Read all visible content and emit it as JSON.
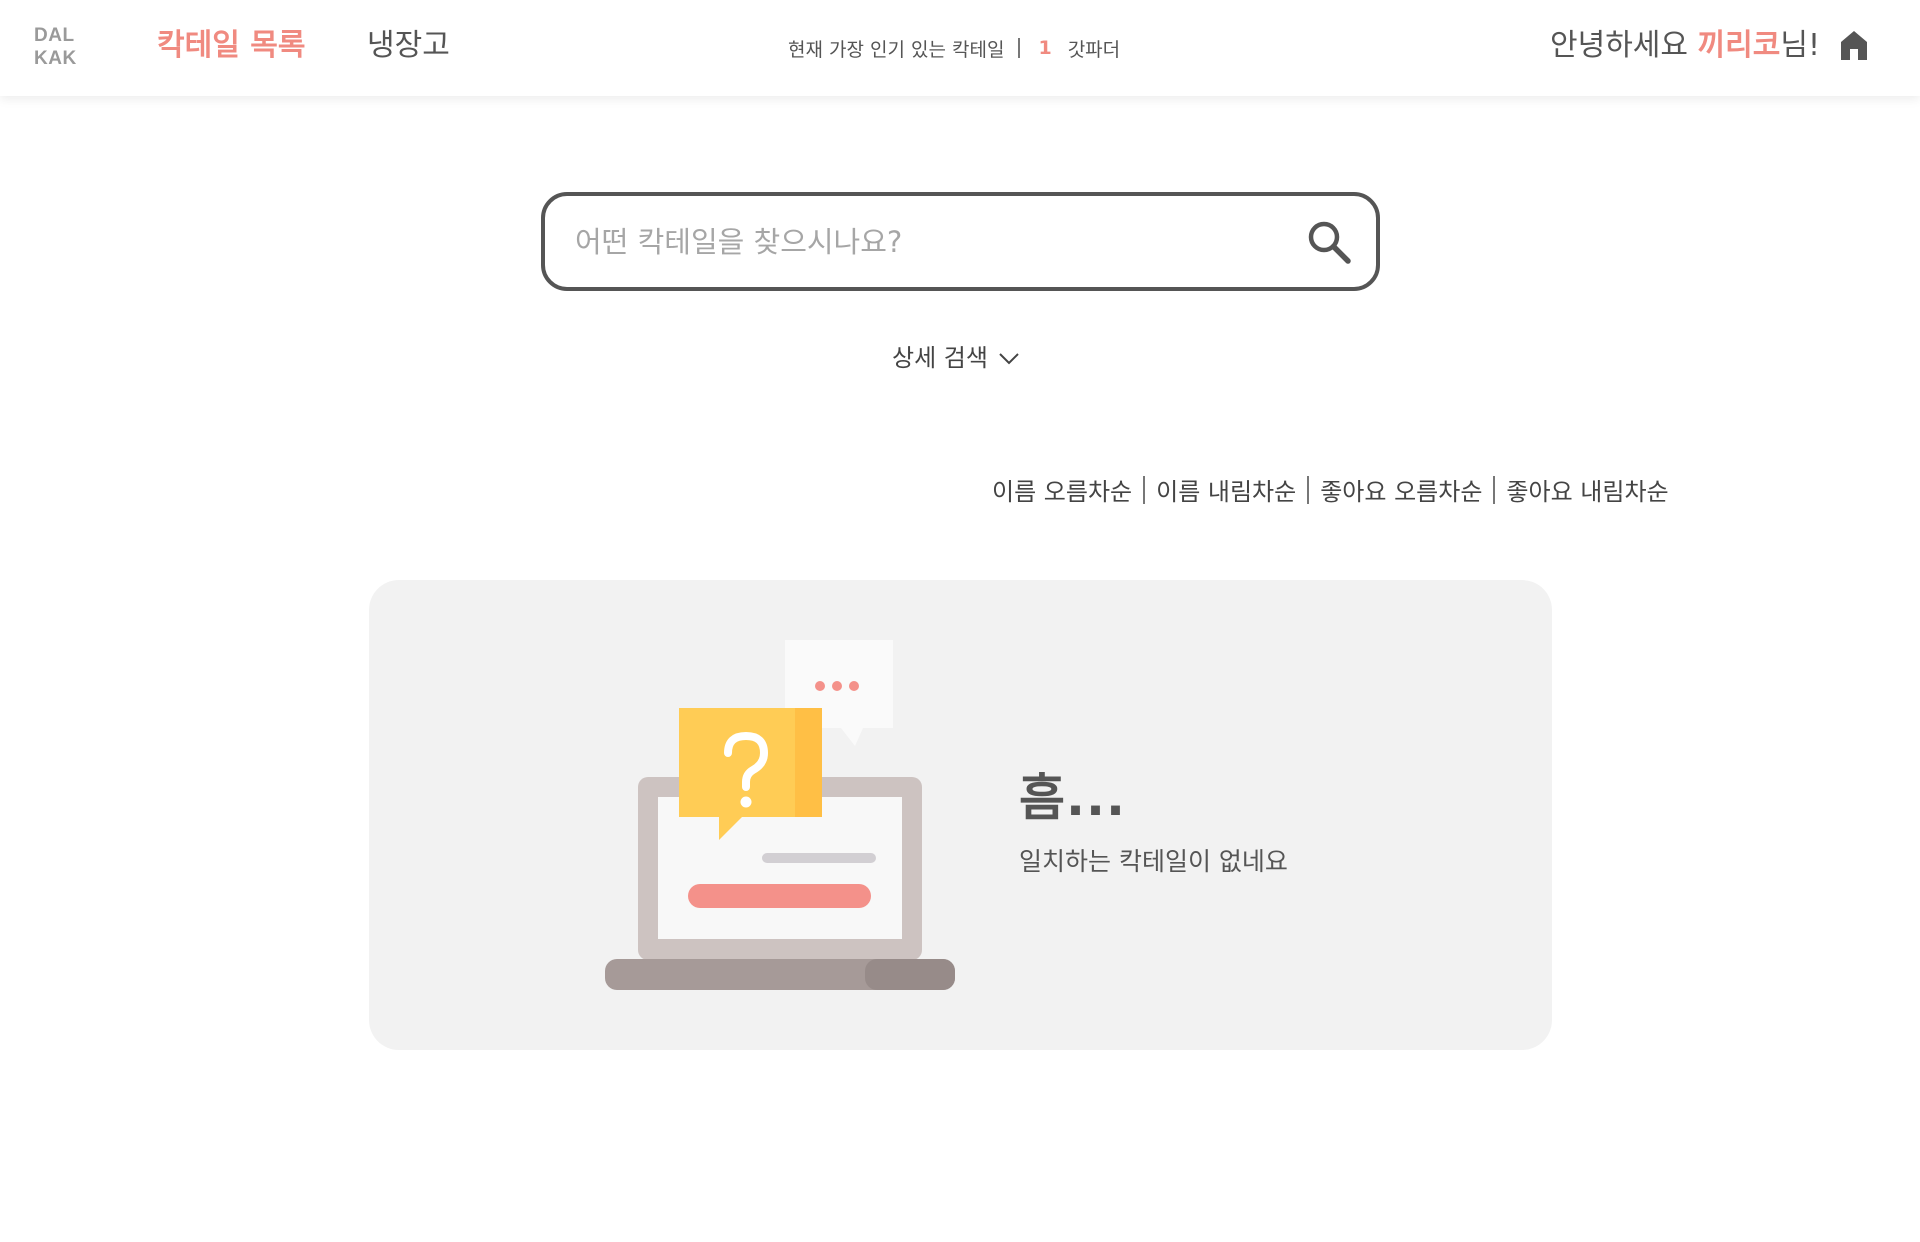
{
  "header": {
    "logo_line1": "DAL",
    "logo_line2": "KAK",
    "nav": {
      "cocktail_list": "칵테일 목록",
      "fridge": "냉장고"
    },
    "popular": {
      "label": "현재 가장 인기 있는 칵테일",
      "rank": "1",
      "name": "갓파더"
    },
    "greeting": {
      "prefix": "안녕하세요 ",
      "username": "끼리코",
      "suffix": "님!"
    },
    "home_icon": "home-icon"
  },
  "search": {
    "placeholder": "어떤 칵테일을 찾으시나요?",
    "value": "",
    "icon": "search-icon",
    "advanced_label": "상세 검색",
    "advanced_icon": "chevron-down-icon"
  },
  "sort": {
    "options": [
      "이름 오름차순",
      "이름 내림차순",
      "좋아요 오름차순",
      "좋아요 내림차순"
    ]
  },
  "empty_state": {
    "title": "흠...",
    "message": "일치하는 칵테일이 없네요"
  },
  "colors": {
    "accent": "#f08a80",
    "text": "#555555",
    "card_bg": "#f2f2f2",
    "bubble_yellow": "#ffcc55"
  }
}
